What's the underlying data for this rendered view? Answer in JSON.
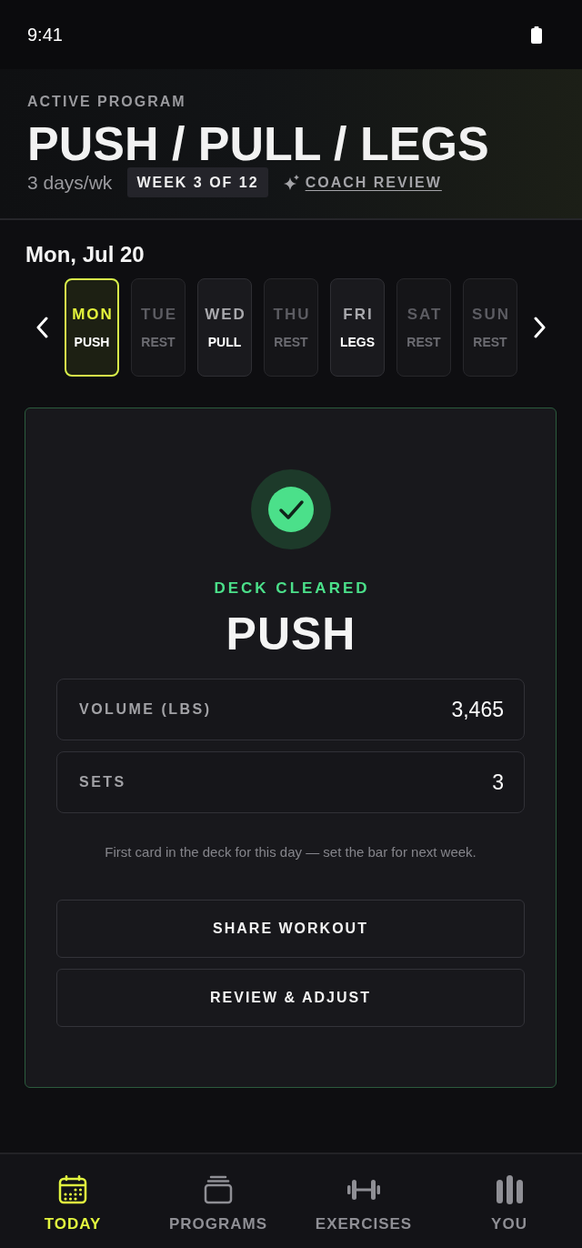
{
  "status_bar": {
    "time": "9:41"
  },
  "header": {
    "eyebrow": "ACTIVE PROGRAM",
    "title": "PUSH / PULL / LEGS",
    "frequency": "3 days/wk",
    "week_badge": "WEEK 3 OF 12",
    "coach_link": "COACH REVIEW"
  },
  "date": "Mon, Jul 20",
  "days": [
    {
      "day": "MON",
      "label": "PUSH",
      "kind": "workout",
      "selected": true
    },
    {
      "day": "TUE",
      "label": "REST",
      "kind": "rest",
      "selected": false
    },
    {
      "day": "WED",
      "label": "PULL",
      "kind": "workout",
      "selected": false
    },
    {
      "day": "THU",
      "label": "REST",
      "kind": "rest",
      "selected": false
    },
    {
      "day": "FRI",
      "label": "LEGS",
      "kind": "workout",
      "selected": false
    },
    {
      "day": "SAT",
      "label": "REST",
      "kind": "rest",
      "selected": false
    },
    {
      "day": "SUN",
      "label": "REST",
      "kind": "rest",
      "selected": false
    }
  ],
  "summary": {
    "status": "DECK CLEARED",
    "title": "PUSH",
    "stats": [
      {
        "label": "VOLUME (LBS)",
        "value": "3,465"
      },
      {
        "label": "SETS",
        "value": "3"
      }
    ],
    "note": "First card in the deck for this day — set the bar for next week.",
    "buttons": [
      "SHARE WORKOUT",
      "REVIEW & ADJUST"
    ]
  },
  "tab_bar": [
    {
      "label": "TODAY",
      "selected": true
    },
    {
      "label": "PROGRAMS",
      "selected": false
    },
    {
      "label": "EXERCISES",
      "selected": false
    },
    {
      "label": "YOU",
      "selected": false
    }
  ]
}
